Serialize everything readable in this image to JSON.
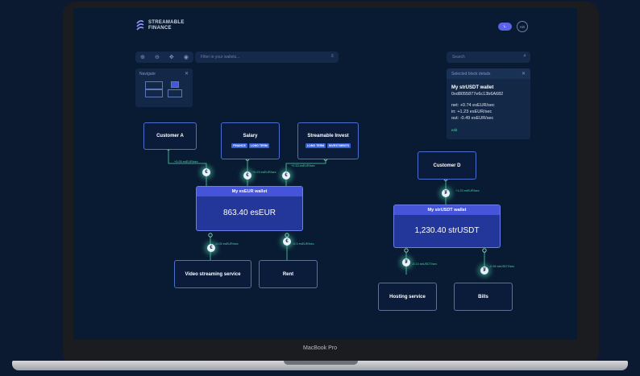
{
  "device": {
    "model": "MacBook Pro"
  },
  "header": {
    "brand_line1": "STREAMABLE",
    "brand_line2": "FINANCE",
    "toggle_label": "⏾",
    "avatar_initials": "AG"
  },
  "toolbar": {
    "icons": [
      "zoom-in-icon",
      "zoom-out-icon",
      "move-icon",
      "eye-icon"
    ],
    "filter_placeholder": "Filter in your wallets...",
    "search_placeholder": "Search"
  },
  "navigator": {
    "title": "Navigate"
  },
  "details": {
    "title": "Selected block details",
    "name": "My strUSDT wallet",
    "address": "0xd8055877e6c13b6A682",
    "net": "net: +0.74 esEUR/sec",
    "in": "in: +1.23 esEUR/sec",
    "out": "out: -0.49 esEUR/sec",
    "edit": "edit"
  },
  "nodes": {
    "customer_a": "Customer A",
    "salary": {
      "label": "Salary",
      "tags": [
        "FINANCE",
        "LONG TERM"
      ]
    },
    "invest": {
      "label": "Streamable Invest",
      "tags": [
        "LONG TERM",
        "INVESTMENTS"
      ]
    },
    "customer_d": "Customer D",
    "video": "Video streaming service",
    "rent": "Rent",
    "hosting": "Hosting service",
    "bills": "Bills"
  },
  "wallets": {
    "eur": {
      "title": "My esEUR wallet",
      "balance": "863.40 esEUR"
    },
    "usdt": {
      "title": "My strUSDT wallet",
      "balance": "1,230.40 strUSDT"
    }
  },
  "rates": {
    "a": "+0.05 esEUR/sec",
    "salary": "+0.23 esEUR/sec",
    "invest": "+0.33 esEUR/sec",
    "video": "-0.05 esEUR/sec",
    "rent": "-0.3 esEUR/sec",
    "d": "+1.23 esEUR/sec",
    "hosting": "-0.13 strUSDT/sec",
    "bills": "-0.36 strUSDT/sec"
  },
  "coins": {
    "eur_symbol": "€",
    "usdt_symbol": "₮"
  },
  "colors": {
    "accent": "#4654d9",
    "flow": "#4fd1a5",
    "background": "#091b33"
  }
}
